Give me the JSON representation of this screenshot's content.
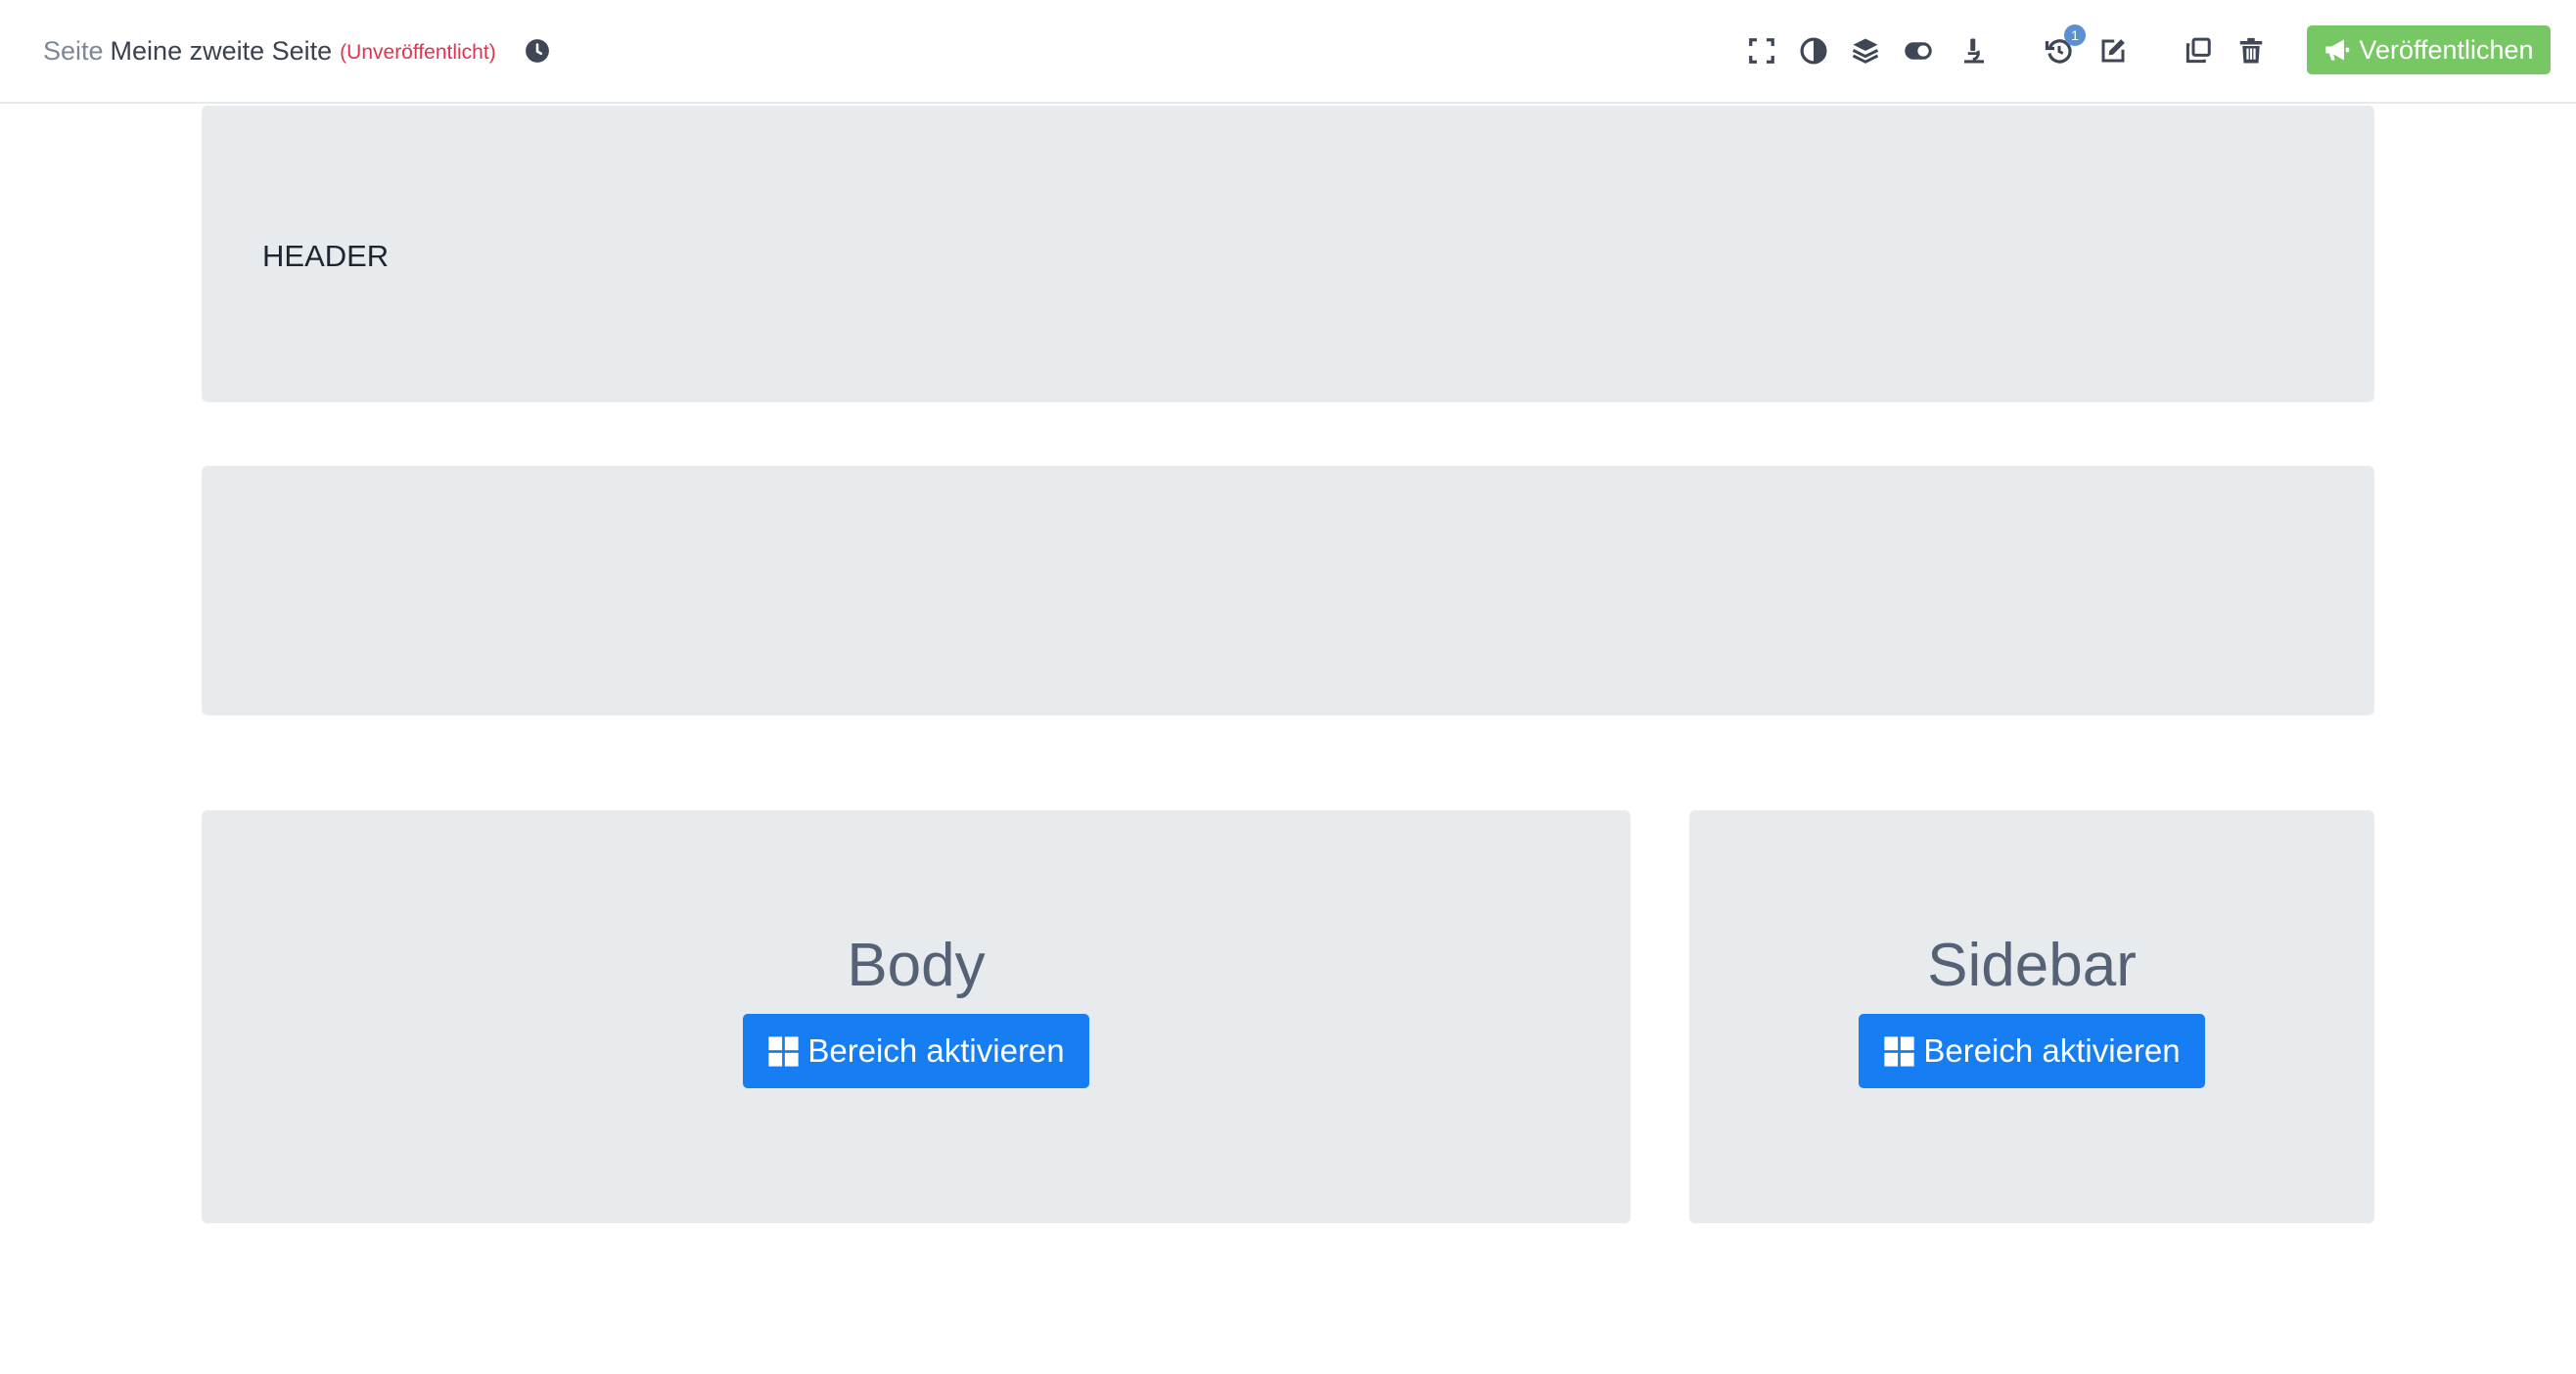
{
  "topbar": {
    "breadcrumb_kind": "Seite",
    "page_name": "Meine zweite Seite",
    "status": "(Unveröffentlicht)",
    "history_count": "1",
    "publish_label": "Veröffentlichen"
  },
  "icons": {
    "clock": "clock-icon",
    "fullscreen": "expand-icon",
    "contrast": "contrast-icon",
    "layers": "layers-icon",
    "toggle": "toggle-icon",
    "inspect": "microscope-icon",
    "history": "history-icon",
    "edit": "edit-icon",
    "duplicate": "copy-icon",
    "delete": "trash-icon",
    "publish": "megaphone-icon",
    "activate": "grid-icon"
  },
  "content": {
    "header_label": "HEADER",
    "body": {
      "title": "Body",
      "button_label": "Bereich aktivieren"
    },
    "sidebar": {
      "title": "Sidebar",
      "button_label": "Bereich aktivieren"
    }
  },
  "colors": {
    "accent": "#167ef2",
    "publish": "#77c864",
    "status": "#e0334f",
    "panel": "#e8ebee"
  }
}
